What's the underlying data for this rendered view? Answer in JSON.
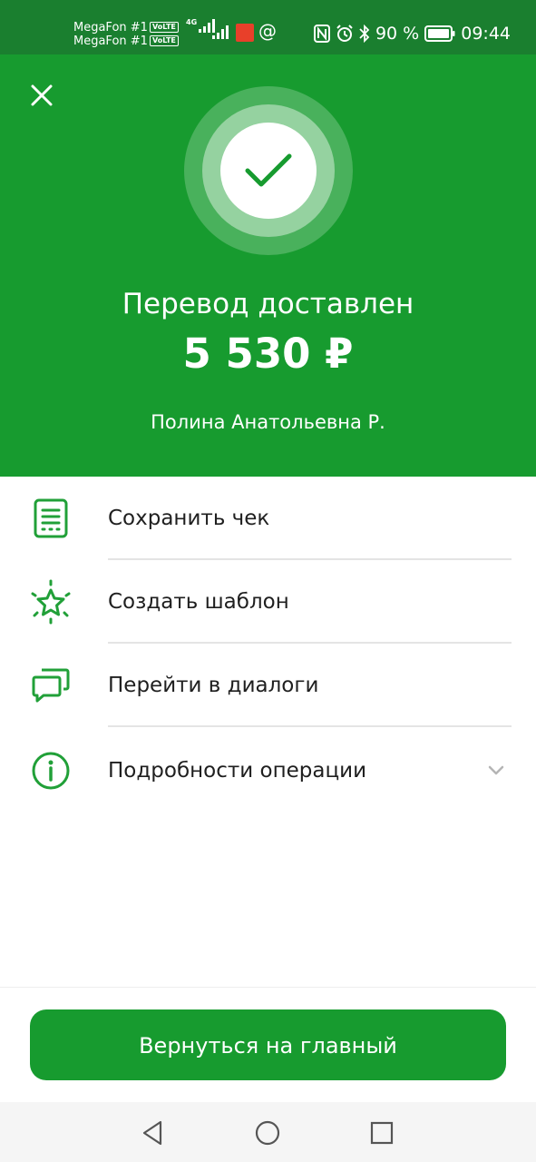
{
  "status_bar": {
    "carrier_1": "MegaFon #1",
    "carrier_2": "MegaFon #1",
    "volte": "VoLTE",
    "network": "4G",
    "battery": "90 %",
    "time": "09:44"
  },
  "hero": {
    "title": "Перевод доставлен",
    "amount": "5 530 ₽",
    "recipient": "Полина Анатольевна Р."
  },
  "actions": [
    {
      "label": "Сохранить чек",
      "icon": "receipt-icon"
    },
    {
      "label": "Создать шаблон",
      "icon": "star-sparkle-icon"
    },
    {
      "label": "Перейти в диалоги",
      "icon": "chat-bubbles-icon"
    },
    {
      "label": "Подробности операции",
      "icon": "info-icon"
    }
  ],
  "main_button": {
    "label": "Вернуться на главный"
  },
  "colors": {
    "brand_green": "#179b2f",
    "status_green": "#1a7f2f",
    "icon_green": "#21a038"
  }
}
